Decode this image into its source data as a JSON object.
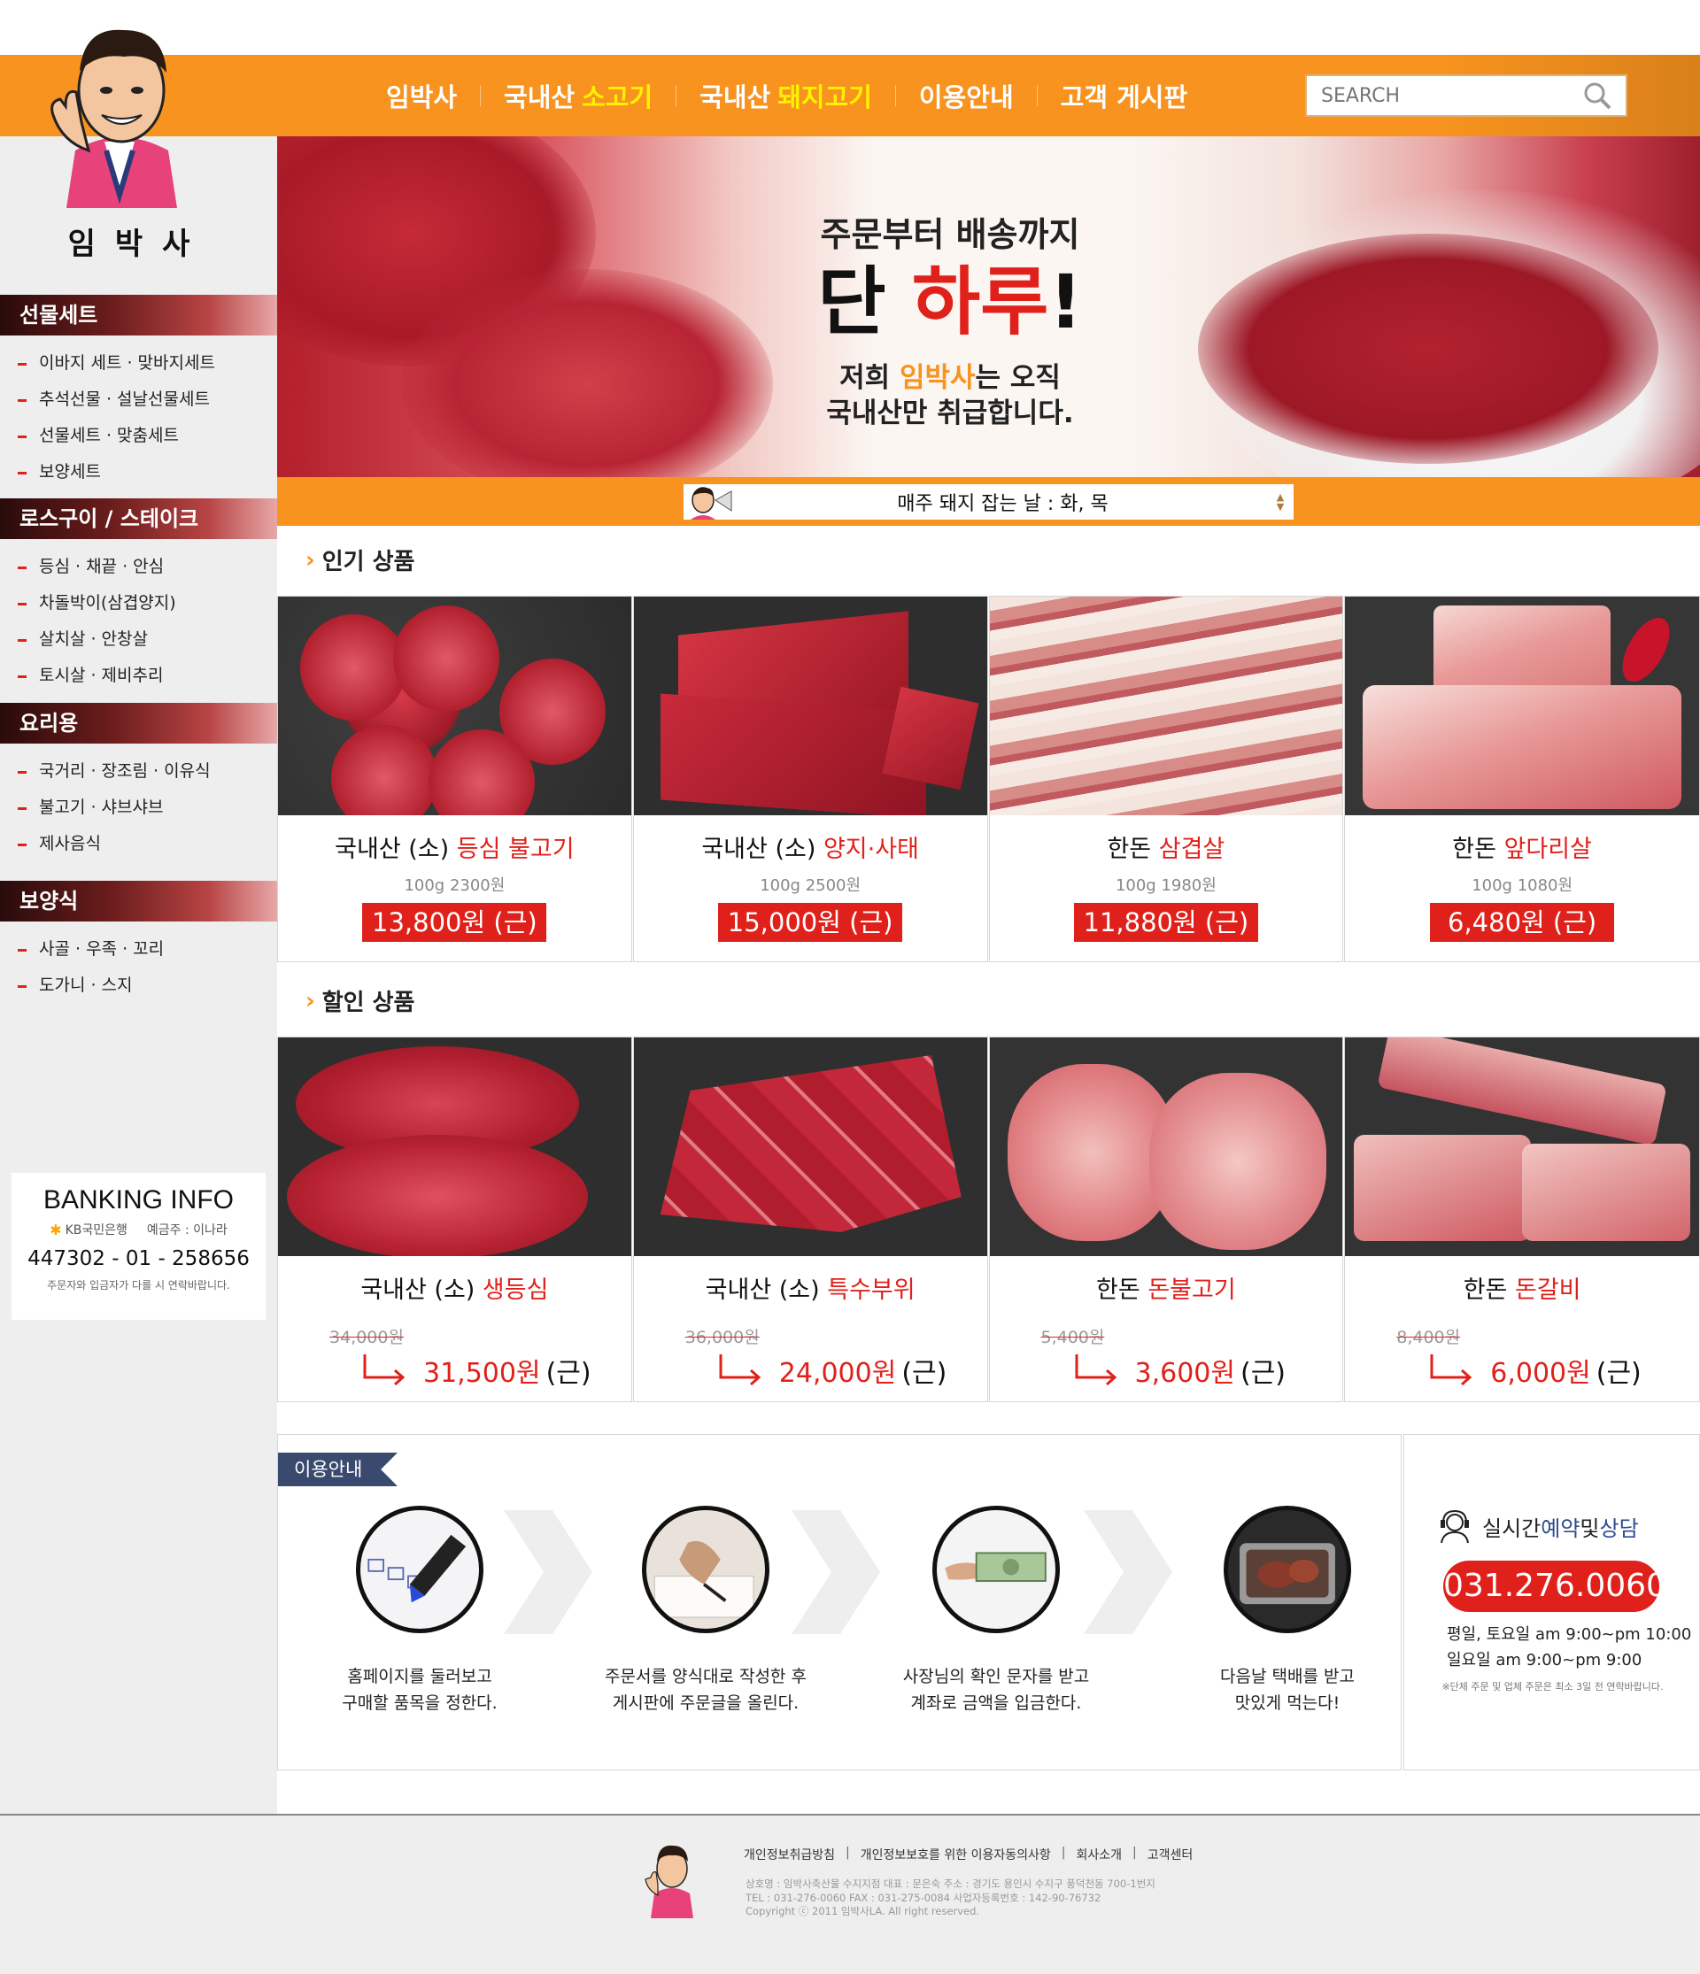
{
  "header": {
    "nav": [
      {
        "label": "임박사",
        "highlight": ""
      },
      {
        "label": "국내산",
        "highlight": "소고기"
      },
      {
        "label": "국내산",
        "highlight": "돼지고기"
      },
      {
        "label": "이용안내",
        "highlight": ""
      },
      {
        "label": "고객 게시판",
        "highlight": ""
      }
    ],
    "search_placeholder": "SEARCH"
  },
  "sidebar": {
    "logo_text": "임박사",
    "categories": [
      {
        "title": "선물세트",
        "items": [
          "이바지 세트 · 맞바지세트",
          "추석선물 · 설날선물세트",
          "선물세트 · 맞춤세트",
          "보양세트"
        ]
      },
      {
        "title": "로스구이 / 스테이크",
        "items": [
          "등심 · 채끝 · 안심",
          "차돌박이(삼겹양지)",
          "살치살 · 안창살",
          "토시살 · 제비추리"
        ]
      },
      {
        "title": "요리용",
        "items": [
          "국거리 · 장조림 · 이유식",
          "불고기 · 샤브샤브",
          "제사음식"
        ]
      },
      {
        "title": "보양식",
        "items": [
          "사골 · 우족 · 꼬리",
          "도가니 · 스지"
        ]
      }
    ],
    "banking": {
      "title": "BANKING INFO",
      "bank": "KB국민은행",
      "holder": "예금주 : 이나라",
      "account": "447302 - 01 - 258656",
      "note": "주문자와 입금자가 다를 시 연락바랍니다."
    }
  },
  "hero": {
    "line1": "주문부터 배송까지",
    "line2_a": "단 ",
    "line2_b": "하루",
    "line2_c": "!",
    "line3_a": "저희 ",
    "line3_b": "임박사",
    "line3_c": "는 오직",
    "line4": "국내산만 취급합니다."
  },
  "notice": {
    "text": "매주 돼지 잡는 날 : 화, 목"
  },
  "popular": {
    "title": "인기 상품",
    "items": [
      {
        "name_a": "국내산 (소) ",
        "name_b": "등심 불고기",
        "unit": "100g 2300원",
        "price": "13,800원 (근)"
      },
      {
        "name_a": "국내산 (소) ",
        "name_b": "양지·사태",
        "unit": "100g 2500원",
        "price": "15,000원 (근)"
      },
      {
        "name_a": "한돈 ",
        "name_b": "삼겹살",
        "unit": "100g 1980원",
        "price": "11,880원 (근)"
      },
      {
        "name_a": "한돈 ",
        "name_b": "앞다리살",
        "unit": "100g 1080원",
        "price": "6,480원 (근)"
      }
    ]
  },
  "discount": {
    "title": "할인 상품",
    "items": [
      {
        "name_a": "국내산 (소) ",
        "name_b": "생등심",
        "old": "34,000원",
        "price": "31,500원",
        "unit": "(근)"
      },
      {
        "name_a": "국내산 (소) ",
        "name_b": "특수부위",
        "old": "36,000원",
        "price": "24,000원",
        "unit": "(근)"
      },
      {
        "name_a": "한돈 ",
        "name_b": "돈불고기",
        "old": "5,400원",
        "price": "3,600원",
        "unit": "(근)"
      },
      {
        "name_a": "한돈 ",
        "name_b": "돈갈비",
        "old": "8,400원",
        "price": "6,000원",
        "unit": "(근)"
      }
    ]
  },
  "guide": {
    "tag": "이용안내",
    "steps": [
      {
        "l1": "홈페이지를 둘러보고",
        "l2": "구매할 품목을 정한다."
      },
      {
        "l1": "주문서를 양식대로 작성한 후",
        "l2": "게시판에 주문글을 올린다."
      },
      {
        "l1": "사장님의 확인 문자를 받고",
        "l2": "계좌로 금액을 입금한다."
      },
      {
        "l1": "다음날 택배를 받고",
        "l2": "맛있게 먹는다!"
      }
    ]
  },
  "contact": {
    "title_a": "실시간 ",
    "title_b": "예약",
    "title_c": " 및 ",
    "title_d": "상담",
    "phone": "031.276.0060",
    "hours1": "평일, 토요일 am 9:00~pm 10:00",
    "hours2": "일요일 am 9:00~pm 9:00",
    "note": "※단체 주문 및 업체 주문은 최소 3일 전 연락바랍니다."
  },
  "footer": {
    "links": [
      "개인정보취급방침",
      "개인정보보호를 위한 이용자동의사항",
      "회사소개",
      "고객센터"
    ],
    "info1": "상호명 : 임박사축산물 수지지점  대표 : 문은숙  주소 : 경기도 용인시 수지구 풍덕천동 700-1번지",
    "info2": "TEL : 031-276-0060  FAX : 031-275-0084  사업자등록번호 : 142-90-76732",
    "info3": "Copyright ⓒ 2011 임박사LA. All right reserved."
  },
  "colors": {
    "orange": "#f7931e",
    "red": "#e0211b",
    "yellow": "#fff100",
    "navy": "#394a6e"
  }
}
